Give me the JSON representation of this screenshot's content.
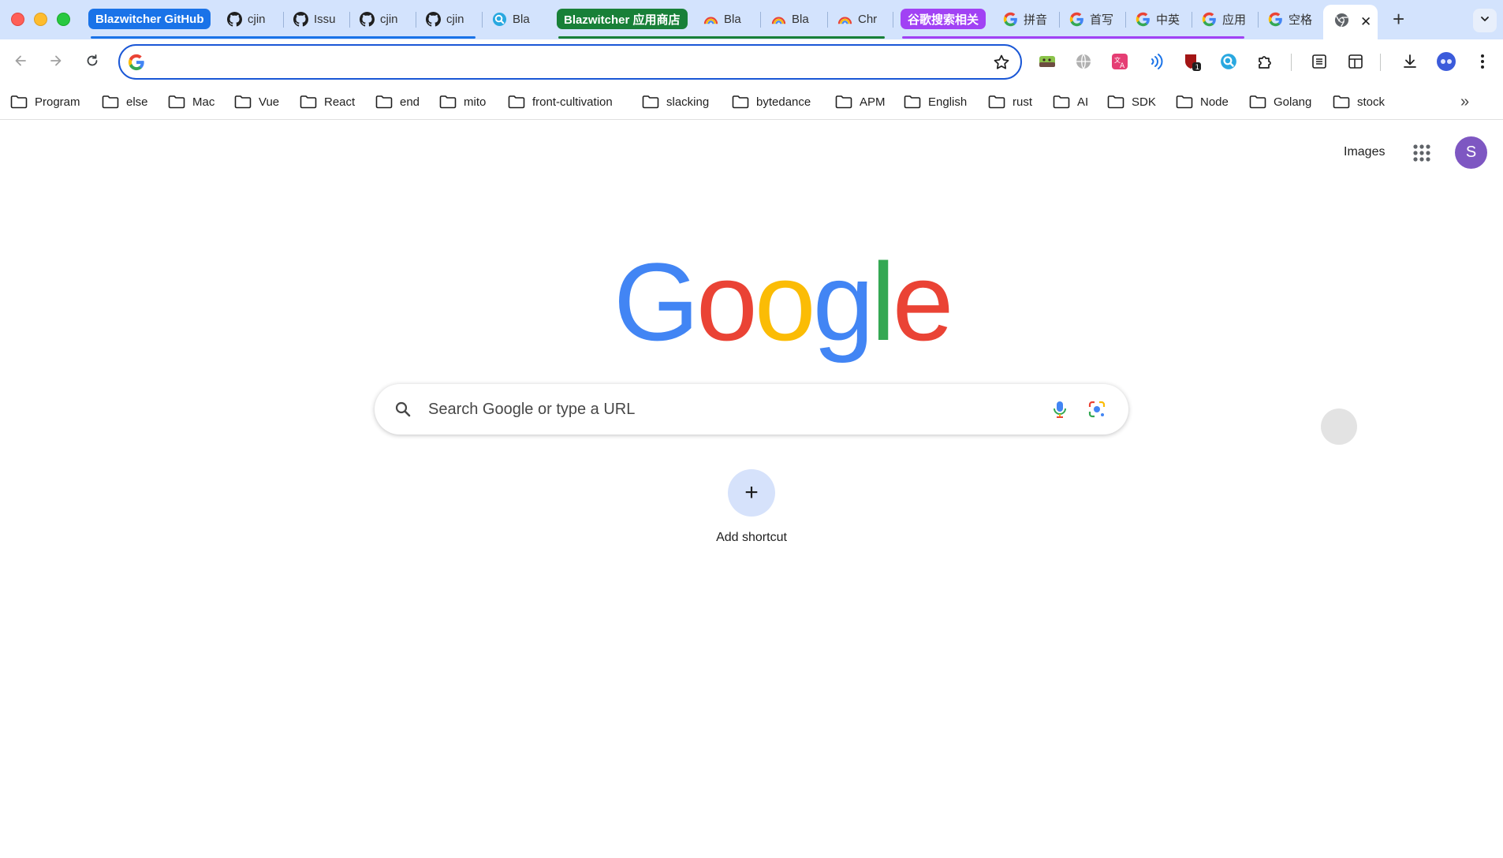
{
  "tabs": {
    "groups": [
      {
        "label": "Blazwitcher GitHub",
        "color": "#1a73e8"
      },
      {
        "label": "Blazwitcher 应用商店",
        "color": "#188038"
      },
      {
        "label": "谷歌搜索相关",
        "color": "#a142f4"
      }
    ],
    "items": [
      {
        "title": "cjin",
        "icon": "github-icon"
      },
      {
        "title": "Issu",
        "icon": "github-icon"
      },
      {
        "title": "cjin",
        "icon": "github-icon"
      },
      {
        "title": "cjin",
        "icon": "github-icon"
      },
      {
        "title": "Bla",
        "icon": "blazwitcher-icon"
      },
      {
        "title": "Bla",
        "icon": "rainbow-icon"
      },
      {
        "title": "Bla",
        "icon": "rainbow-icon"
      },
      {
        "title": "Chr",
        "icon": "rainbow-icon"
      },
      {
        "title": "拼音",
        "icon": "google-g-icon"
      },
      {
        "title": "首写",
        "icon": "google-g-icon"
      },
      {
        "title": "中英",
        "icon": "google-g-icon"
      },
      {
        "title": "应用",
        "icon": "google-g-icon"
      },
      {
        "title": "空格",
        "icon": "google-g-icon"
      }
    ],
    "active": {
      "icon": "chrome-icon",
      "close": "✕"
    },
    "new_tab": "+"
  },
  "toolbar": {
    "address_value": "",
    "extensions": [
      "battery-extension-icon",
      "globe-extension-icon",
      "translate-extension-icon",
      "wave-extension-icon",
      "shield-extension-icon",
      "search-extension-icon",
      "puzzle-extensions-icon"
    ],
    "shield_badge": "1"
  },
  "bookmarks": [
    "Program",
    "else",
    "Mac",
    "Vue",
    "React",
    "end",
    "mito",
    "front-cultivation",
    "slacking",
    "bytedance",
    "APM",
    "English",
    "rust",
    "AI",
    "SDK",
    "Node",
    "Golang",
    "stock"
  ],
  "bookmarks_more": "»",
  "header": {
    "images": "Images",
    "avatar_letter": "S"
  },
  "logo": {
    "letters": [
      "G",
      "o",
      "o",
      "g",
      "l",
      "e"
    ],
    "colors": [
      "#4285f4",
      "#ea4335",
      "#fbbc05",
      "#4285f4",
      "#34a853",
      "#ea4335"
    ]
  },
  "search": {
    "placeholder": "Search Google or type a URL"
  },
  "shortcut": {
    "plus": "+",
    "label": "Add shortcut"
  }
}
